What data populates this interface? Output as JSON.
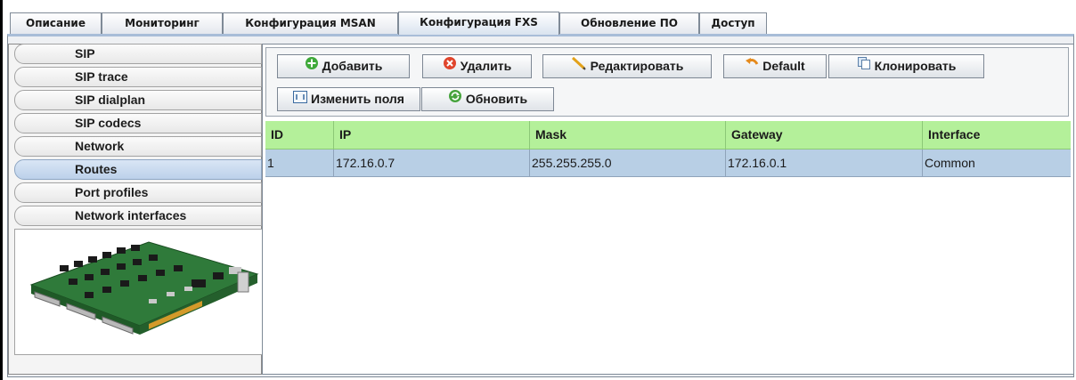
{
  "tabs": [
    {
      "label": "Описание"
    },
    {
      "label": "Мониторинг"
    },
    {
      "label": "Конфигурация MSAN"
    },
    {
      "label": "Конфигурация FXS"
    },
    {
      "label": "Обновление ПО"
    },
    {
      "label": "Доступ"
    }
  ],
  "active_tab": "Конфигурация FXS",
  "sidebar": {
    "items": [
      {
        "label": "SIP"
      },
      {
        "label": "SIP trace"
      },
      {
        "label": "SIP dialplan"
      },
      {
        "label": "SIP codecs"
      },
      {
        "label": "Network"
      },
      {
        "label": "Routes"
      },
      {
        "label": "Port profiles"
      },
      {
        "label": "Network interfaces"
      }
    ],
    "selected": "Routes"
  },
  "toolbar": {
    "add_label": "Добавить",
    "delete_label": "Удалить",
    "edit_label": "Редактировать",
    "default_label": "Default",
    "clone_label": "Клонировать",
    "change_fields_label": "Изменить поля",
    "refresh_label": "Обновить"
  },
  "table": {
    "columns": [
      "ID",
      "IP",
      "Mask",
      "Gateway",
      "Interface"
    ],
    "rows": [
      {
        "id": "1",
        "ip": "172.16.0.7",
        "mask": "255.255.255.0",
        "gateway": "172.16.0.1",
        "interface": "Common"
      }
    ]
  },
  "colors": {
    "header_green": "#b4f09a",
    "selected_row_blue": "#b8cfe5",
    "selected_nav_blue": "#c6d8ee",
    "board_green": "#2f7a3a"
  },
  "icons": {
    "add": "plus-circle-icon",
    "delete": "x-circle-icon",
    "edit": "pencil-icon",
    "default": "undo-arrow-icon",
    "clone": "copy-pages-icon",
    "change_fields": "columns-icon",
    "refresh": "refresh-icon",
    "board": "circuit-board-image"
  }
}
